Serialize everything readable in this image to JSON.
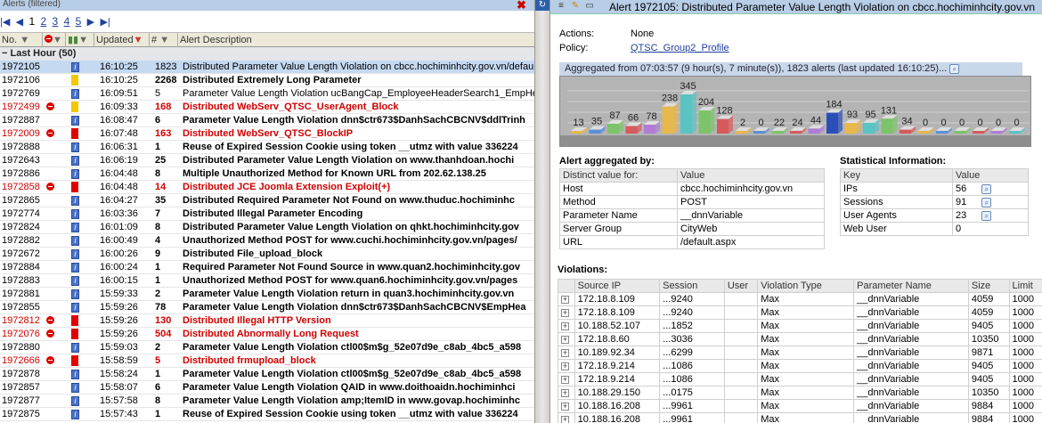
{
  "left_pane": {
    "title": "Alerts (filtered)",
    "pager": {
      "pages": [
        "1",
        "2",
        "3",
        "4",
        "5"
      ],
      "current": "1"
    },
    "columns": {
      "no": "No.",
      "updated": "Updated",
      "count": "#",
      "desc": "Alert Description"
    },
    "group_label": "Last Hour (50)",
    "rows": [
      {
        "no": "1972105",
        "sev": "info",
        "time": "16:10:25",
        "count": "1823",
        "desc": "Distributed Parameter Value Length Violation on cbcc.hochiminhcity.gov.vn/defau",
        "red": false,
        "bold": false,
        "selected": true,
        "stop": false
      },
      {
        "no": "1972106",
        "sev": "yellow",
        "time": "16:10:25",
        "count": "2268",
        "desc": "Distributed Extremely Long Parameter",
        "red": false,
        "bold": true,
        "selected": false,
        "stop": false
      },
      {
        "no": "1972769",
        "sev": "info",
        "time": "16:09:51",
        "count": "5",
        "desc": "Parameter Value Length Violation ucBangCap_EmployeeHeaderSearch1_EmpHeaderSe",
        "red": false,
        "bold": false,
        "selected": false,
        "stop": false
      },
      {
        "no": "1972499",
        "sev": "yellow",
        "time": "16:09:33",
        "count": "168",
        "desc": "Distributed WebServ_QTSC_UserAgent_Block",
        "red": true,
        "bold": false,
        "selected": false,
        "stop": true
      },
      {
        "no": "1972887",
        "sev": "info",
        "time": "16:08:47",
        "count": "6",
        "desc": "Parameter Value Length Violation dnn$ctr673$DanhSachCBCNV$ddlTrinh",
        "red": false,
        "bold": true,
        "selected": false,
        "stop": false
      },
      {
        "no": "1972009",
        "sev": "red",
        "time": "16:07:48",
        "count": "163",
        "desc": "Distributed WebServ_QTSC_BlockIP",
        "red": true,
        "bold": false,
        "selected": false,
        "stop": true
      },
      {
        "no": "1972888",
        "sev": "info",
        "time": "16:06:31",
        "count": "1",
        "desc": "Reuse of Expired Session Cookie using token __utmz with value 336224",
        "red": false,
        "bold": true,
        "selected": false,
        "stop": false
      },
      {
        "no": "1972643",
        "sev": "info",
        "time": "16:06:19",
        "count": "25",
        "desc": "Distributed Parameter Value Length Violation on www.thanhdoan.hochi",
        "red": false,
        "bold": true,
        "selected": false,
        "stop": false
      },
      {
        "no": "1972886",
        "sev": "info",
        "time": "16:04:48",
        "count": "8",
        "desc": "Multiple Unauthorized Method for Known URL from 202.62.138.25",
        "red": false,
        "bold": true,
        "selected": false,
        "stop": false
      },
      {
        "no": "1972858",
        "sev": "red",
        "time": "16:04:48",
        "count": "14",
        "desc": "Distributed JCE Joomla Extension Exploit(+)",
        "red": true,
        "bold": false,
        "selected": false,
        "stop": true
      },
      {
        "no": "1972865",
        "sev": "info",
        "time": "16:04:27",
        "count": "35",
        "desc": "Distributed Required Parameter Not Found on www.thuduc.hochiminhc",
        "red": false,
        "bold": true,
        "selected": false,
        "stop": false
      },
      {
        "no": "1972774",
        "sev": "info",
        "time": "16:03:36",
        "count": "7",
        "desc": "Distributed Illegal Parameter Encoding",
        "red": false,
        "bold": true,
        "selected": false,
        "stop": false
      },
      {
        "no": "1972824",
        "sev": "info",
        "time": "16:01:09",
        "count": "8",
        "desc": "Distributed Parameter Value Length Violation on qhkt.hochiminhcity.gov",
        "red": false,
        "bold": true,
        "selected": false,
        "stop": false
      },
      {
        "no": "1972882",
        "sev": "info",
        "time": "16:00:49",
        "count": "4",
        "desc": "Unauthorized Method POST for www.cuchi.hochiminhcity.gov.vn/pages/",
        "red": false,
        "bold": true,
        "selected": false,
        "stop": false
      },
      {
        "no": "1972672",
        "sev": "info",
        "time": "16:00:26",
        "count": "9",
        "desc": "Distributed File_upload_block",
        "red": false,
        "bold": true,
        "selected": false,
        "stop": false
      },
      {
        "no": "1972884",
        "sev": "info",
        "time": "16:00:24",
        "count": "1",
        "desc": "Required Parameter Not Found Source in www.quan2.hochiminhcity.gov",
        "red": false,
        "bold": true,
        "selected": false,
        "stop": false
      },
      {
        "no": "1972883",
        "sev": "info",
        "time": "16:00:15",
        "count": "1",
        "desc": "Unauthorized Method POST for www.quan6.hochiminhcity.gov.vn/pages",
        "red": false,
        "bold": true,
        "selected": false,
        "stop": false
      },
      {
        "no": "1972881",
        "sev": "info",
        "time": "15:59:33",
        "count": "2",
        "desc": "Parameter Value Length Violation return in quan3.hochiminhcity.gov.vn",
        "red": false,
        "bold": true,
        "selected": false,
        "stop": false
      },
      {
        "no": "1972855",
        "sev": "info",
        "time": "15:59:26",
        "count": "78",
        "desc": "Parameter Value Length Violation dnn$ctr673$DanhSachCBCNV$EmpHea",
        "red": false,
        "bold": true,
        "selected": false,
        "stop": false
      },
      {
        "no": "1972812",
        "sev": "red",
        "time": "15:59:26",
        "count": "130",
        "desc": "Distributed Illegal HTTP Version",
        "red": true,
        "bold": false,
        "selected": false,
        "stop": true
      },
      {
        "no": "1972076",
        "sev": "red",
        "time": "15:59:26",
        "count": "504",
        "desc": "Distributed Abnormally Long Request",
        "red": true,
        "bold": false,
        "selected": false,
        "stop": true
      },
      {
        "no": "1972880",
        "sev": "info",
        "time": "15:59:03",
        "count": "2",
        "desc": "Parameter Value Length Violation ctl00$m$g_52e07d9e_c8ab_4bc5_a598",
        "red": false,
        "bold": true,
        "selected": false,
        "stop": false
      },
      {
        "no": "1972666",
        "sev": "red",
        "time": "15:58:59",
        "count": "5",
        "desc": "Distributed frmupload_block",
        "red": true,
        "bold": false,
        "selected": false,
        "stop": true
      },
      {
        "no": "1972878",
        "sev": "info",
        "time": "15:58:24",
        "count": "1",
        "desc": "Parameter Value Length Violation ctl00$m$g_52e07d9e_c8ab_4bc5_a598",
        "red": false,
        "bold": true,
        "selected": false,
        "stop": false
      },
      {
        "no": "1972857",
        "sev": "info",
        "time": "15:58:07",
        "count": "6",
        "desc": "Parameter Value Length Violation QAID in www.doithoaidn.hochiminhci",
        "red": false,
        "bold": true,
        "selected": false,
        "stop": false
      },
      {
        "no": "1972877",
        "sev": "info",
        "time": "15:57:58",
        "count": "8",
        "desc": "Parameter Value Length Violation amp;ItemID in www.govap.hochiminhc",
        "red": false,
        "bold": true,
        "selected": false,
        "stop": false
      },
      {
        "no": "1972875",
        "sev": "info",
        "time": "15:57:43",
        "count": "1",
        "desc": "Reuse of Expired Session Cookie using token __utmz with value 336224",
        "red": false,
        "bold": true,
        "selected": false,
        "stop": false
      }
    ]
  },
  "right_pane": {
    "title": "Alert 1972105: Distributed Parameter Value Length Violation on cbcc.hochiminhcity.gov.vn",
    "actions_label": "Actions:",
    "actions_value": "None",
    "policy_label": "Policy:",
    "policy_value": "QTSC_Group2_Profile",
    "aggregated_text": "Aggregated from 07:03:57 (9 hour(s), 7 minute(s)), 1823  alerts (last updated 16:10:25)...",
    "aggregated_by": {
      "title": "Alert aggregated by:",
      "col_key": "Distinct value for:",
      "col_val": "Value",
      "rows": [
        {
          "k": "Host",
          "v": "cbcc.hochiminhcity.gov.vn"
        },
        {
          "k": "Method",
          "v": "POST"
        },
        {
          "k": "Parameter Name",
          "v": "__dnnVariable"
        },
        {
          "k": "Server Group",
          "v": "CityWeb"
        },
        {
          "k": "URL",
          "v": "/default.aspx"
        }
      ]
    },
    "stats": {
      "title": "Statistical Information:",
      "col_key": "Key",
      "col_val": "Value",
      "rows": [
        {
          "k": "IPs",
          "v": "56",
          "mag": true
        },
        {
          "k": "Sessions",
          "v": "91",
          "mag": true
        },
        {
          "k": "User Agents",
          "v": "23",
          "mag": true
        },
        {
          "k": "Web User",
          "v": "0",
          "mag": false
        }
      ]
    },
    "violations": {
      "title": "Violations:",
      "columns": [
        "Source IP",
        "Session",
        "User",
        "Violation Type",
        "Parameter Name",
        "Size",
        "Limit"
      ],
      "rows": [
        [
          "172.18.8.109",
          "...9240",
          "",
          "Max",
          "__dnnVariable",
          "4059",
          "1000"
        ],
        [
          "172.18.8.109",
          "...9240",
          "",
          "Max",
          "__dnnVariable",
          "4059",
          "1000"
        ],
        [
          "10.188.52.107",
          "...1852",
          "",
          "Max",
          "__dnnVariable",
          "9405",
          "1000"
        ],
        [
          "172.18.8.60",
          "...3036",
          "",
          "Max",
          "__dnnVariable",
          "10350",
          "1000"
        ],
        [
          "10.189.92.34",
          "...6299",
          "",
          "Max",
          "__dnnVariable",
          "9871",
          "1000"
        ],
        [
          "172.18.9.214",
          "...1086",
          "",
          "Max",
          "__dnnVariable",
          "9405",
          "1000"
        ],
        [
          "172.18.9.214",
          "...1086",
          "",
          "Max",
          "__dnnVariable",
          "9405",
          "1000"
        ],
        [
          "10.188.29.150",
          "...0175",
          "",
          "Max",
          "__dnnVariable",
          "10350",
          "1000"
        ],
        [
          "10.188.16.208",
          "...9961",
          "",
          "Max",
          "__dnnVariable",
          "9884",
          "1000"
        ],
        [
          "10.188.16.208",
          "...9961",
          "",
          "Max",
          "__dnnVariable",
          "9884",
          "1000"
        ]
      ]
    }
  },
  "chart_data": {
    "type": "bar",
    "values": [
      13,
      35,
      87,
      66,
      78,
      238,
      345,
      204,
      128,
      2,
      0,
      22,
      24,
      44,
      184,
      93,
      95,
      131,
      34,
      0,
      0,
      0,
      0,
      0,
      0
    ],
    "colors": [
      "#e8b84a",
      "#5a8fd6",
      "#7cc36a",
      "#d65a5a",
      "#b07cd6",
      "#e8b84a",
      "#5ac3c3",
      "#7cc36a",
      "#d65a5a",
      "#e8b84a",
      "#5a8fd6",
      "#7cc36a",
      "#d65a5a",
      "#b07cd6",
      "#2a4fb8",
      "#e8b84a",
      "#5ac3c3",
      "#7cc36a",
      "#d65a5a",
      "#e8b84a",
      "#5a8fd6",
      "#7cc36a",
      "#d65a5a",
      "#b07cd6",
      "#5ac3c3"
    ]
  }
}
